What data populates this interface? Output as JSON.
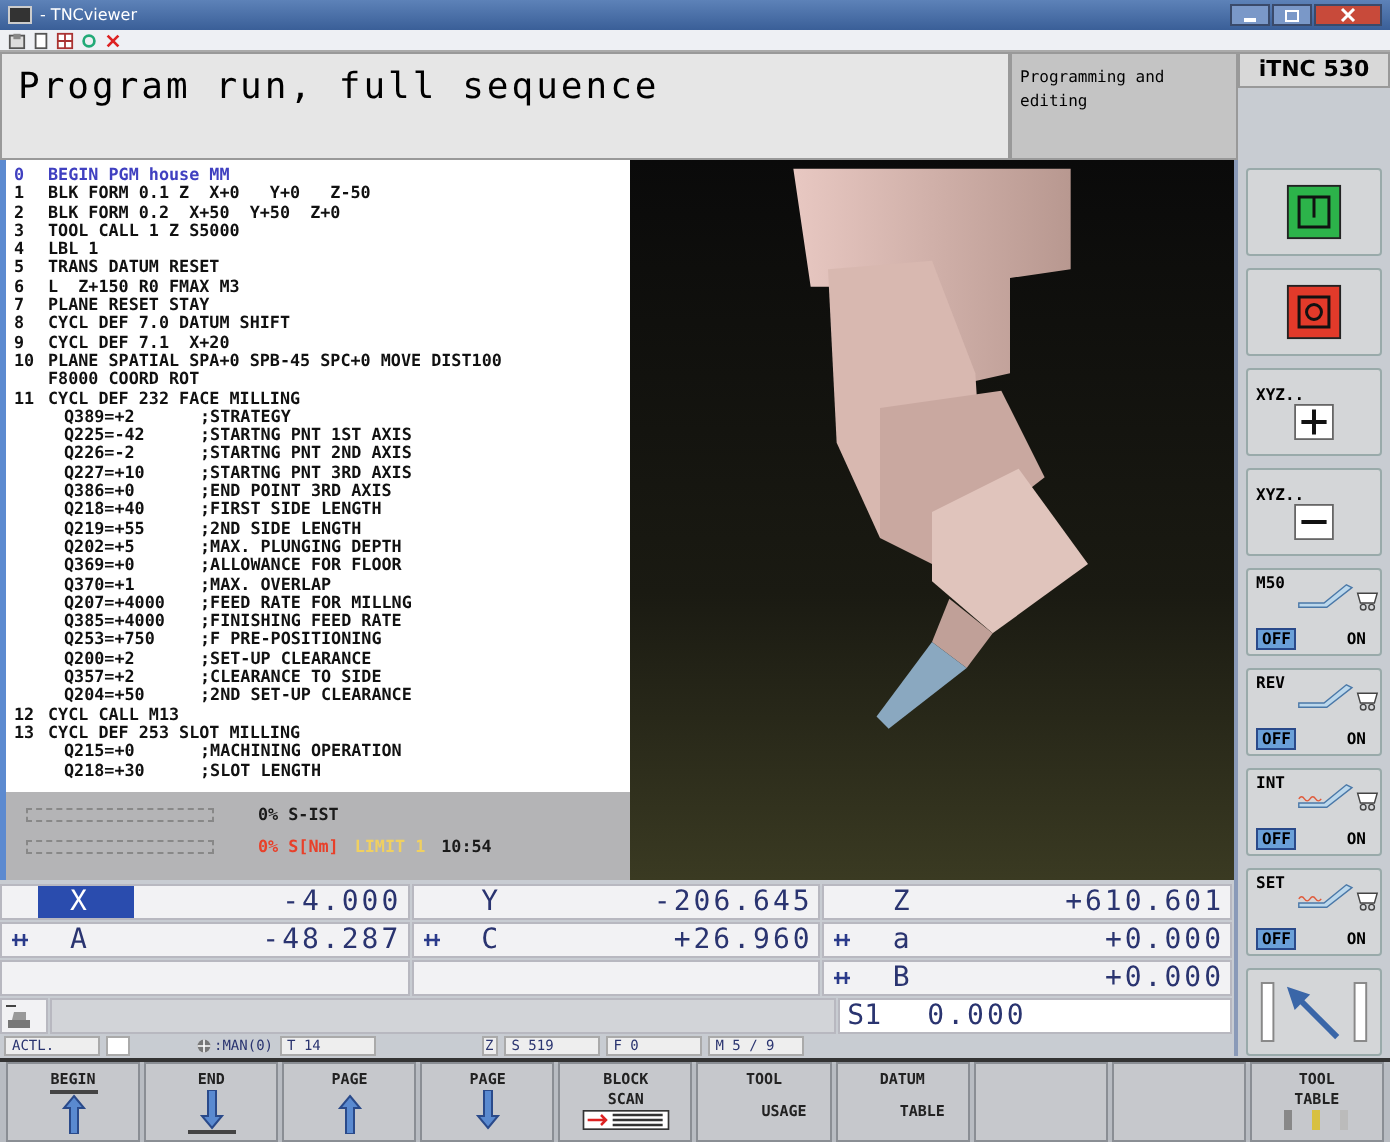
{
  "window": {
    "title": "- TNCviewer"
  },
  "header": {
    "title": "Program run, full sequence",
    "mode": "Programming and editing",
    "brand": "iTNC 530"
  },
  "program": {
    "lines": [
      {
        "number": "0",
        "text": "BEGIN PGM house MM",
        "selected": true
      },
      {
        "number": "1",
        "text": "BLK FORM 0.1 Z  X+0   Y+0   Z-50",
        "selected": false
      },
      {
        "number": "2",
        "text": "BLK FORM 0.2  X+50  Y+50  Z+0",
        "selected": false
      },
      {
        "number": "3",
        "text": "TOOL CALL 1 Z S5000",
        "selected": false
      },
      {
        "number": "4",
        "text": "LBL 1",
        "selected": false
      },
      {
        "number": "5",
        "text": "TRANS DATUM RESET",
        "selected": false
      },
      {
        "number": "6",
        "text": "L  Z+150 R0 FMAX M3",
        "selected": false
      },
      {
        "number": "7",
        "text": "PLANE RESET STAY",
        "selected": false
      },
      {
        "number": "8",
        "text": "CYCL DEF 7.0 DATUM SHIFT",
        "selected": false
      },
      {
        "number": "9",
        "text": "CYCL DEF 7.1  X+20",
        "selected": false
      },
      {
        "number": "10",
        "text": "PLANE SPATIAL SPA+0 SPB-45 SPC+0 MOVE DIST100",
        "selected": false
      },
      {
        "text": "F8000 COORD ROT",
        "selected": false
      },
      {
        "number": "11",
        "text": "CYCL DEF 232 FACE MILLING",
        "selected": false
      },
      {
        "text": "Q389=+2",
        "comment": ";STRATEGY",
        "selected": false
      },
      {
        "text": "Q225=-42",
        "comment": ";STARTNG PNT 1ST AXIS",
        "selected": false
      },
      {
        "text": "Q226=-2",
        "comment": ";STARTNG PNT 2ND AXIS",
        "selected": false
      },
      {
        "text": "Q227=+10",
        "comment": ";STARTNG PNT 3RD AXIS",
        "selected": false
      },
      {
        "text": "Q386=+0",
        "comment": ";END POINT 3RD AXIS",
        "selected": false
      },
      {
        "text": "Q218=+40",
        "comment": ";FIRST SIDE LENGTH",
        "selected": false
      },
      {
        "text": "Q219=+55",
        "comment": ";2ND SIDE LENGTH",
        "selected": false
      },
      {
        "text": "Q202=+5",
        "comment": ";MAX. PLUNGING DEPTH",
        "selected": false
      },
      {
        "text": "Q369=+0",
        "comment": ";ALLOWANCE FOR FLOOR",
        "selected": false
      },
      {
        "text": "Q370=+1",
        "comment": ";MAX. OVERLAP",
        "selected": false
      },
      {
        "text": "Q207=+4000",
        "comment": ";FEED RATE FOR MILLNG",
        "selected": false
      },
      {
        "text": "Q385=+4000",
        "comment": ";FINISHING FEED RATE",
        "selected": false
      },
      {
        "text": "Q253=+750",
        "comment": ";F PRE-POSITIONING",
        "selected": false
      },
      {
        "text": "Q200=+2",
        "comment": ";SET-UP CLEARANCE",
        "selected": false
      },
      {
        "text": "Q357=+2",
        "comment": ";CLEARANCE TO SIDE",
        "selected": false
      },
      {
        "text": "Q204=+50",
        "comment": ";2ND SET-UP CLEARANCE",
        "selected": false
      },
      {
        "number": "12",
        "text": "CYCL CALL M13",
        "selected": false
      },
      {
        "number": "13",
        "text": "CYCL DEF 253 SLOT MILLING",
        "selected": false
      },
      {
        "text": "Q215=+0",
        "comment": ";MACHINING OPERATION",
        "selected": false
      },
      {
        "text": "Q218=+30",
        "comment": ";SLOT LENGTH",
        "selected": false
      }
    ]
  },
  "load": [
    {
      "level": 0,
      "parts": [
        {
          "text": "0% S-IST",
          "color": "#1a1a1a"
        }
      ]
    },
    {
      "level": 0,
      "parts": [
        {
          "text": "0% S[Nm]",
          "color": "#e8402a"
        },
        {
          "text": "LIMIT 1",
          "color": "#f0d060"
        },
        {
          "text": "10:54",
          "color": "#1a1a1a"
        }
      ]
    }
  ],
  "positions": [
    [
      {
        "kind": "axis",
        "axis": "X",
        "value": "-4.000",
        "selected": true,
        "clamped": false
      },
      {
        "kind": "axis",
        "axis": "Y",
        "value": "-206.645",
        "selected": false,
        "clamped": false
      },
      {
        "kind": "axis",
        "axis": "Z",
        "value": "+610.601",
        "selected": false,
        "clamped": false
      }
    ],
    [
      {
        "kind": "axis",
        "axis": "A",
        "value": "-48.287",
        "selected": false,
        "clamped": true
      },
      {
        "kind": "axis",
        "axis": "C",
        "value": "+26.960",
        "selected": false,
        "clamped": true
      },
      {
        "kind": "axis",
        "axis": "a",
        "value": "+0.000",
        "selected": false,
        "clamped": true
      }
    ],
    [
      {
        "kind": "empty"
      },
      {
        "kind": "empty"
      },
      {
        "kind": "axis",
        "axis": "B",
        "value": "+0.000",
        "selected": false,
        "clamped": true
      }
    ],
    [
      {
        "kind": "tool"
      },
      {
        "kind": "blank"
      },
      {
        "kind": "spindle",
        "axis": "S1",
        "value": "0.000"
      }
    ]
  ],
  "status_bar": [
    {
      "kind": "text",
      "text": "ACTL."
    },
    {
      "kind": "box"
    },
    {
      "kind": "icon",
      "text": ":MAN(0)"
    },
    {
      "kind": "text",
      "text": "T 14"
    },
    {
      "kind": "axis",
      "text": "Z"
    },
    {
      "kind": "text",
      "text": "S 519"
    },
    {
      "kind": "text",
      "text": "F 0"
    },
    {
      "kind": "text",
      "text": "M 5 / 9"
    }
  ],
  "sidebar": [
    {
      "kind": "green"
    },
    {
      "kind": "red"
    },
    {
      "kind": "plus",
      "label": "XYZ.."
    },
    {
      "kind": "minus",
      "label": "XYZ.."
    },
    {
      "kind": "switch",
      "label": "M50",
      "off": "OFF",
      "on_label": "ON",
      "on": false,
      "heat": false
    },
    {
      "kind": "switch",
      "label": "REV",
      "off": "OFF",
      "on_label": "ON",
      "on": false,
      "heat": false
    },
    {
      "kind": "switch",
      "label": "INT",
      "off": "OFF",
      "on_label": "ON",
      "on": false,
      "heat": true
    },
    {
      "kind": "switch",
      "label": "SET",
      "off": "OFF",
      "on_label": "ON",
      "on": false,
      "heat": true
    },
    {
      "kind": "arrow"
    }
  ],
  "softkeys": [
    {
      "lines": [
        "BEGIN"
      ],
      "kind": "begin"
    },
    {
      "lines": [
        "END"
      ],
      "kind": "end"
    },
    {
      "lines": [
        "PAGE"
      ],
      "kind": "up"
    },
    {
      "lines": [
        "PAGE"
      ],
      "kind": "down"
    },
    {
      "lines": [
        "BLOCK",
        "SCAN"
      ],
      "kind": "scan"
    },
    {
      "lines": [
        "TOOL",
        "USAGE"
      ],
      "kind": "text"
    },
    {
      "lines": [
        "DATUM",
        "TABLE"
      ],
      "kind": "text"
    },
    {
      "kind": "blank"
    },
    {
      "kind": "blank"
    },
    {
      "lines": [
        "TOOL",
        "TABLE"
      ],
      "kind": "tools"
    }
  ]
}
